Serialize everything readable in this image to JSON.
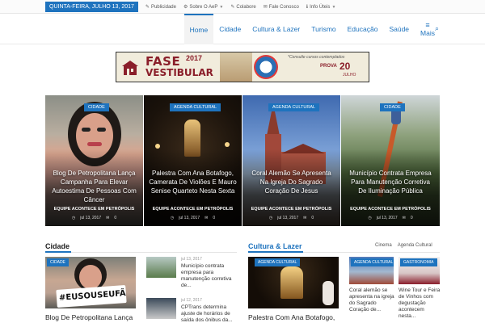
{
  "topbar": {
    "date": "QUINTA-FEIRA, JULHO 13, 2017",
    "items": [
      {
        "icon": "megaphone-icon",
        "glyph": "✎",
        "label": "Publicidade",
        "caret": false
      },
      {
        "icon": "gear-icon",
        "glyph": "⚙",
        "label": "Sobre O AeP",
        "caret": true
      },
      {
        "icon": "edit-icon",
        "glyph": "✎",
        "label": "Colabore",
        "caret": false
      },
      {
        "icon": "chat-icon",
        "glyph": "✉",
        "label": "Fale Conosco",
        "caret": false
      },
      {
        "icon": "info-icon",
        "glyph": "ℹ",
        "label": "Info Úteis",
        "caret": true
      }
    ]
  },
  "nav": {
    "items": [
      "Home",
      "Cidade",
      "Cultura & Lazer",
      "Turismo",
      "Educação",
      "Saúde"
    ],
    "active": "Home",
    "more_label": "Mais",
    "more_glyph": "≡",
    "search_glyph": "⌕"
  },
  "banner": {
    "title": "FASE",
    "year": "2017",
    "subtitle": "VESTIBULAR",
    "note": "*Consulte cursos contemplados",
    "prova": "PROVA",
    "day": "20",
    "month": "JULHO"
  },
  "featured": [
    {
      "category": "CIDADE",
      "title": "Blog De Petropolitana Lança Campanha Para Elevar Autoestima De Pessoas Com Câncer",
      "author": "EQUIPE ACONTECE EM PETRÓPOLIS",
      "date": "jul 13, 2017",
      "comments": "0"
    },
    {
      "category": "AGENDA CULTURAL",
      "title": "Palestra Com Ana Botafogo, Camerata De Violões E Mauro Senise Quarteto Nesta Sexta",
      "author": "EQUIPE ACONTECE EM PETRÓPOLIS",
      "date": "jul 13, 2017",
      "comments": "0"
    },
    {
      "category": "AGENDA CULTURAL",
      "title": "Coral Alemão Se Apresenta Na Igreja Do Sagrado Coração De Jesus",
      "author": "EQUIPE ACONTECE EM PETRÓPOLIS",
      "date": "jul 13, 2017",
      "comments": "0"
    },
    {
      "category": "CIDADE",
      "title": "Município Contrata Empresa Para Manutenção Corretiva De Iluminação Pública",
      "author": "EQUIPE ACONTECE EM PETRÓPOLIS",
      "date": "jul 13, 2017",
      "comments": "0"
    }
  ],
  "cidade": {
    "title": "Cidade",
    "main_badge": "CIDADE",
    "main_image_text": "#EUSOUSEUFÃ",
    "main_title": "Blog De Petropolitana Lança",
    "items": [
      {
        "date": "jul 13, 2017",
        "title": "Município contrata empresa para manutenção corretiva de..."
      },
      {
        "date": "jul 12, 2017",
        "title": "CPTrans determina ajuste de horários de saída dos ônibus da..."
      }
    ]
  },
  "cultura": {
    "title": "Cultura & Lazer",
    "tabs": [
      "Cinema",
      "Agenda Cultural"
    ],
    "main_badge": "AGENDA CULTURAL",
    "main_title": "Palestra Com Ana Botafogo,",
    "cols": [
      {
        "badge": "AGENDA CULTURAL",
        "title": "Coral alemão se apresenta na igreja do Sagrado Coração de..."
      },
      {
        "badge": "GASTRONOMIA",
        "title": "Wine Tour e Feira de Vinhos com degustação acontecem nesta..."
      }
    ]
  },
  "colors": {
    "accent": "#1e73be",
    "banner_red": "#8a1e2a"
  }
}
